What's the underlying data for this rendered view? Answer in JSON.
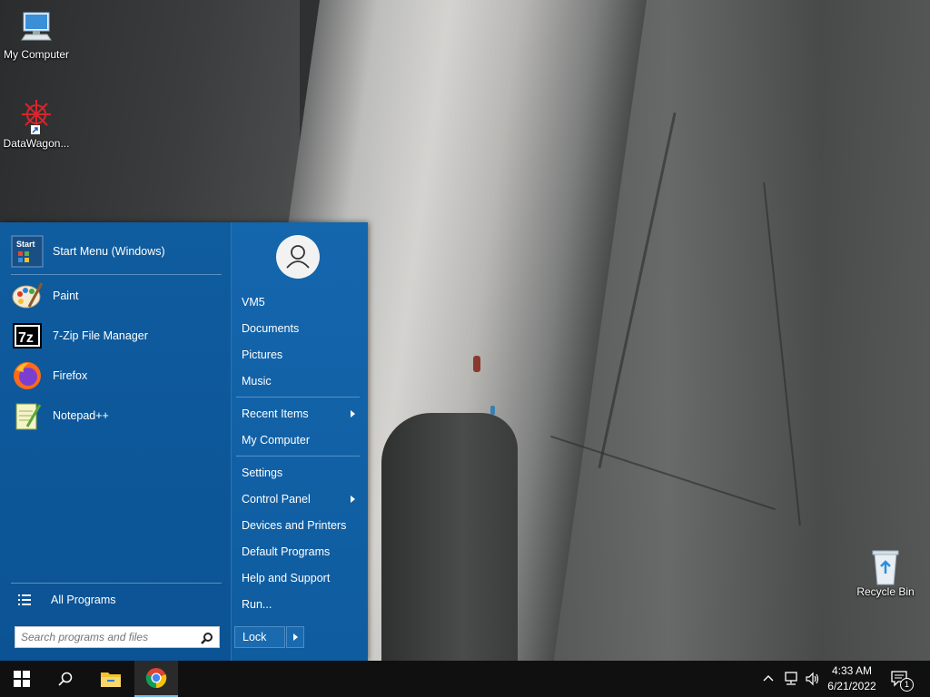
{
  "desktop": {
    "icons": [
      {
        "label": "My Computer",
        "icon": "computer-icon"
      },
      {
        "label": "DataWagon...",
        "icon": "datawagon-icon"
      },
      {
        "label": "Recycle Bin",
        "icon": "recycle-bin-icon"
      }
    ]
  },
  "start_menu": {
    "pinned": [
      {
        "label": "Start Menu (Windows)",
        "icon": "start-menu-icon"
      }
    ],
    "recent": [
      {
        "label": "Paint",
        "icon": "paint-icon"
      },
      {
        "label": "7-Zip File Manager",
        "icon": "7zip-icon"
      },
      {
        "label": "Firefox",
        "icon": "firefox-icon"
      },
      {
        "label": "Notepad++",
        "icon": "notepadpp-icon"
      }
    ],
    "start_icon_text": "Start",
    "sevenzip_icon_text": "7z",
    "all_programs": "All Programs",
    "search_placeholder": "Search programs and files",
    "user": "VM5",
    "right_links": {
      "documents": "Documents",
      "pictures": "Pictures",
      "music": "Music",
      "recent_items": "Recent Items",
      "my_computer": "My Computer",
      "settings": "Settings",
      "control_panel": "Control Panel",
      "devices_printers": "Devices and Printers",
      "default_programs": "Default Programs",
      "help_support": "Help and Support",
      "run": "Run..."
    },
    "lock": "Lock"
  },
  "taskbar": {
    "time": "4:33 AM",
    "date": "6/21/2022",
    "notification_count": "1",
    "accent": "#76b9ed"
  },
  "colors": {
    "menu_left": "#0b5394",
    "menu_right": "#1466ad",
    "taskbar": "#101010"
  }
}
